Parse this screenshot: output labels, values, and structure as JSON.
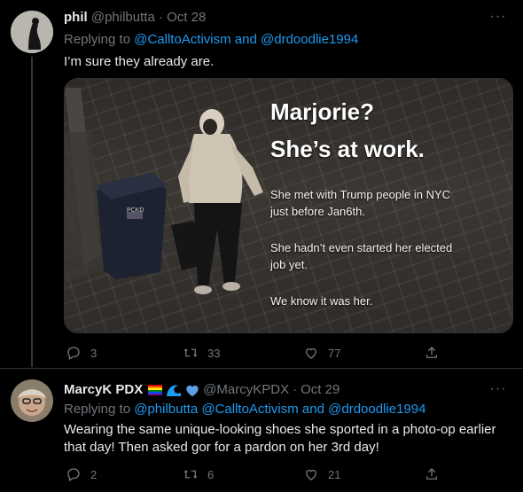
{
  "tweet1": {
    "display_name": "phil",
    "handle": "@philbutta",
    "separator": "·",
    "date": "Oct 28",
    "replying_prefix": "Replying to ",
    "reply_user1": "@CalltoActivism",
    "reply_and": " and ",
    "reply_user2": "@drdoodlie1994",
    "text": "I’m sure they already are.",
    "media": {
      "title_line1": "Marjorie?",
      "title_line2": "She’s at work.",
      "line1": "She met  with Trump people in NYC",
      "line2": "just before Jan6th.",
      "line3": "She hadn’t even started her elected",
      "line4": "job yet.",
      "line5": "We know it was her.",
      "bin_label": "PCKD"
    },
    "reply_count": "3",
    "retweet_count": "33",
    "like_count": "77"
  },
  "tweet2": {
    "display_name": "MarcyK PDX",
    "handle": "@MarcyKPDX",
    "separator": "·",
    "date": "Oct 29",
    "replying_prefix": "Replying to ",
    "reply_user1": "@philbutta",
    "reply_space": " ",
    "reply_user2": "@CalltoActivism",
    "reply_and": " and ",
    "reply_user3": "@drdoodlie1994",
    "text_line1": "Wearing the same unique-looking shoes she sported in a photo-op earlier",
    "text_line2": "that day! Then asked gor for a pardon on her 3rd day!",
    "reply_count": "2",
    "retweet_count": "6",
    "like_count": "21"
  },
  "icons": [
    "more-icon",
    "reply-icon",
    "retweet-icon",
    "like-icon",
    "share-icon",
    "rainbow-flag-icon",
    "wave-icon",
    "heart-icon"
  ],
  "colors": {
    "background": "#000000",
    "text": "#e7e9ea",
    "muted": "#71767b",
    "link": "#1d9bf0"
  }
}
